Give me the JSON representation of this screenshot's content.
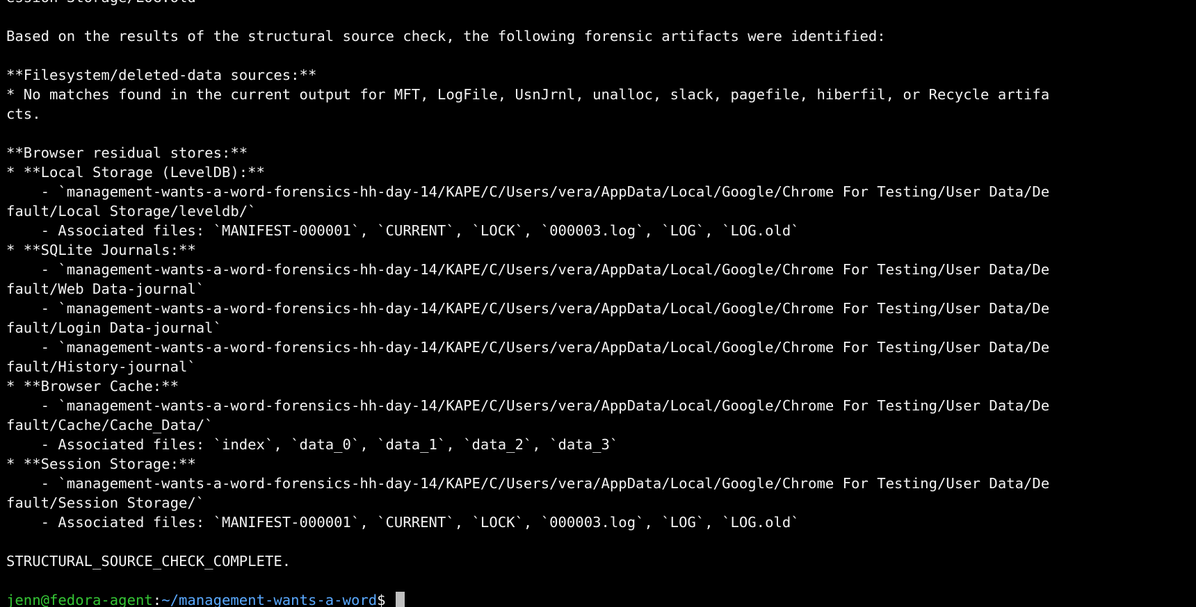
{
  "terminal": {
    "lines": [
      "ession Storage/LOG.old",
      "",
      "Based on the results of the structural source check, the following forensic artifacts were identified:",
      "",
      "**Filesystem/deleted-data sources:**",
      "* No matches found in the current output for MFT, LogFile, UsnJrnl, unalloc, slack, pagefile, hiberfil, or Recycle artifa",
      "cts.",
      "",
      "**Browser residual stores:**",
      "* **Local Storage (LevelDB):**",
      "    - `management-wants-a-word-forensics-hh-day-14/KAPE/C/Users/vera/AppData/Local/Google/Chrome For Testing/User Data/De",
      "fault/Local Storage/leveldb/`",
      "    - Associated files: `MANIFEST-000001`, `CURRENT`, `LOCK`, `000003.log`, `LOG`, `LOG.old`",
      "* **SQLite Journals:**",
      "    - `management-wants-a-word-forensics-hh-day-14/KAPE/C/Users/vera/AppData/Local/Google/Chrome For Testing/User Data/De",
      "fault/Web Data-journal`",
      "    - `management-wants-a-word-forensics-hh-day-14/KAPE/C/Users/vera/AppData/Local/Google/Chrome For Testing/User Data/De",
      "fault/Login Data-journal`",
      "    - `management-wants-a-word-forensics-hh-day-14/KAPE/C/Users/vera/AppData/Local/Google/Chrome For Testing/User Data/De",
      "fault/History-journal`",
      "* **Browser Cache:**",
      "    - `management-wants-a-word-forensics-hh-day-14/KAPE/C/Users/vera/AppData/Local/Google/Chrome For Testing/User Data/De",
      "fault/Cache/Cache_Data/`",
      "    - Associated files: `index`, `data_0`, `data_1`, `data_2`, `data_3`",
      "* **Session Storage:**",
      "    - `management-wants-a-word-forensics-hh-day-14/KAPE/C/Users/vera/AppData/Local/Google/Chrome For Testing/User Data/De",
      "fault/Session Storage/`",
      "    - Associated files: `MANIFEST-000001`, `CURRENT`, `LOCK`, `000003.log`, `LOG`, `LOG.old`",
      "",
      "STRUCTURAL_SOURCE_CHECK_COMPLETE.",
      ""
    ],
    "prompt": {
      "user_host": "jenn@fedora-agent",
      "separator": ":",
      "path": "~/management-wants-a-word",
      "symbol": "$ "
    },
    "colors": {
      "background": "#000000",
      "text": "#f2f2f2",
      "prompt_user": "#35c435",
      "prompt_path": "#5aa9ff",
      "cursor": "#bfbfbf"
    }
  }
}
